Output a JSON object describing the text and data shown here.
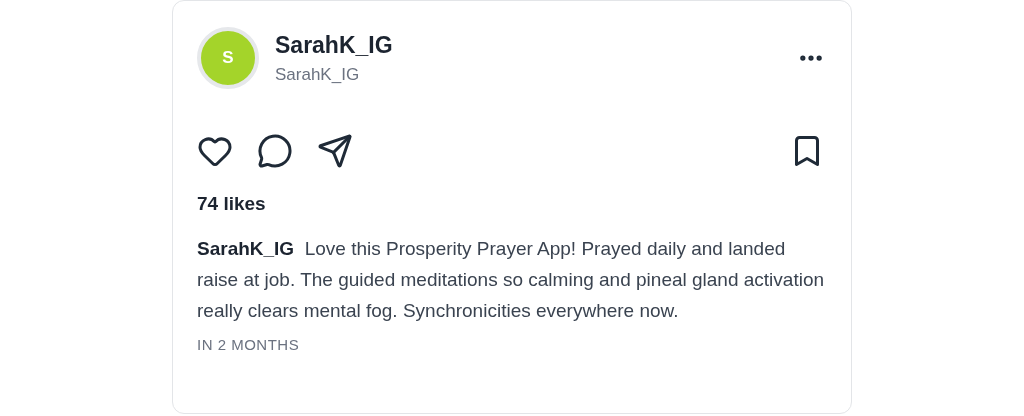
{
  "post": {
    "avatar": {
      "initial": "S",
      "color": "#a4d42a"
    },
    "display_name": "SarahK_IG",
    "handle": "SarahK_IG",
    "actions": {
      "liked": false,
      "saved": false
    },
    "likes": "74 likes",
    "caption": "**SarahK_IG**  Love this Prosperity Prayer App! Prayed daily and landed raise at job. The guided meditations so calming and pineal gland activation really clears mental fog. Synchronicities everywhere now.",
    "timestamp": "IN 2 MONTHS"
  }
}
